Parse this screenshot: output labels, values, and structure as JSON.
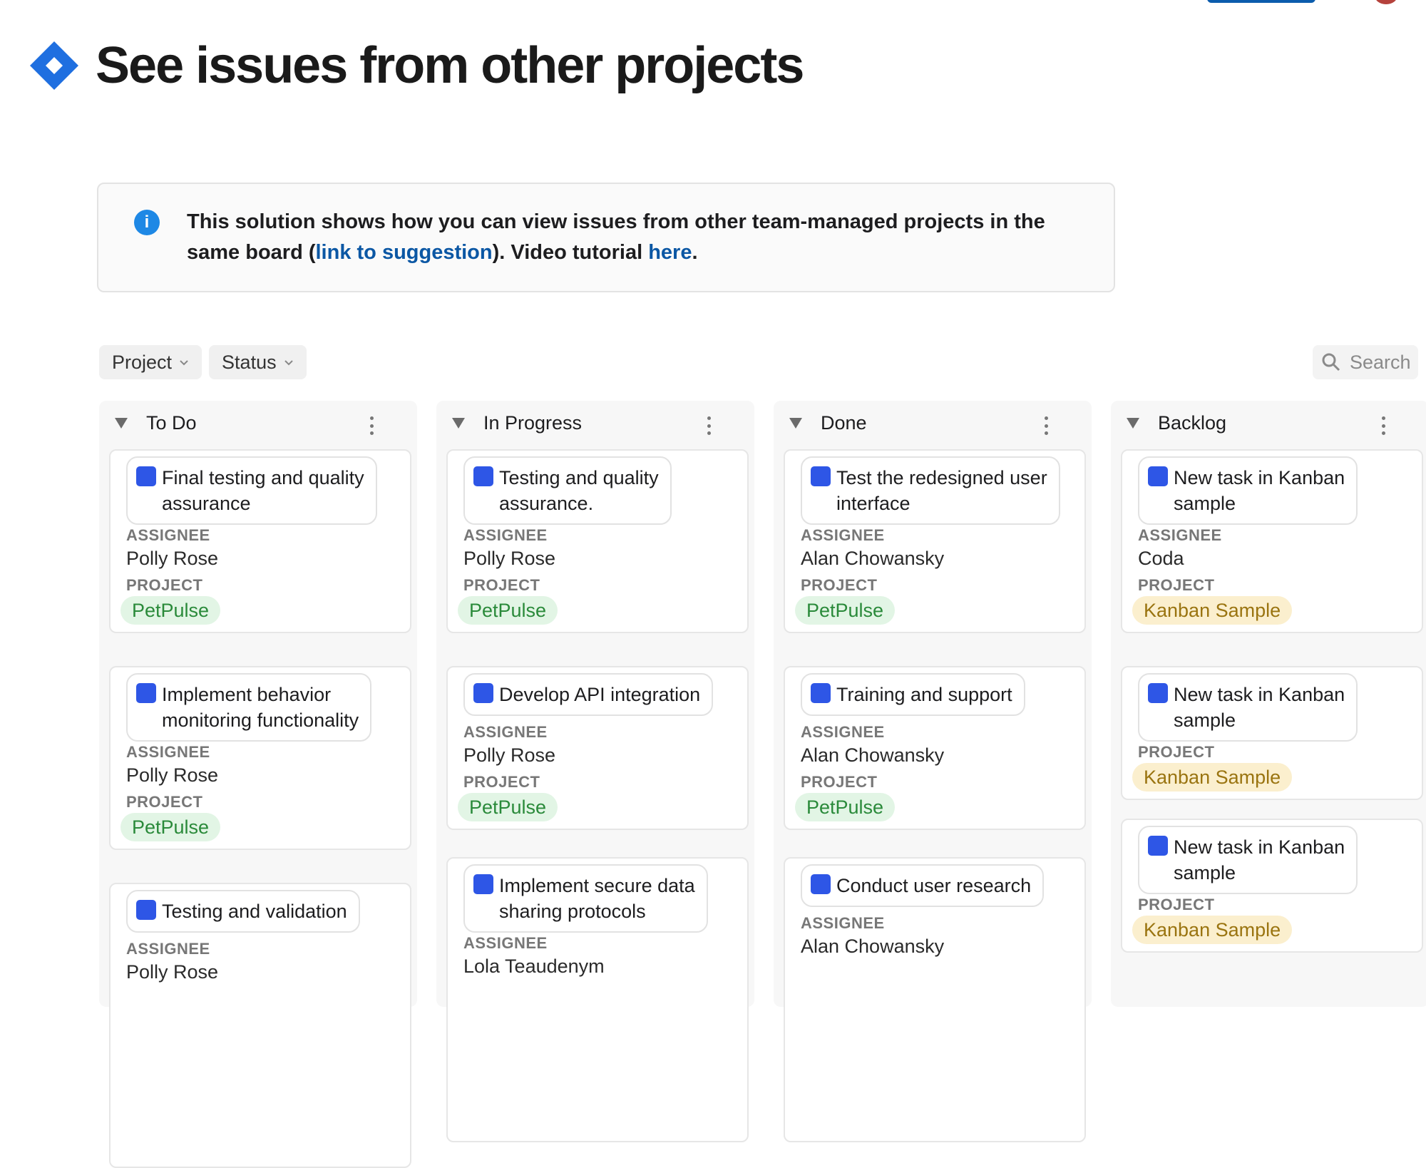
{
  "page": {
    "title": "See issues from other projects"
  },
  "callout": {
    "text_part1": "This solution shows how you can view issues from other team-managed projects in the same board (",
    "link1": "link to suggestion",
    "text_part2": "). Video tutorial ",
    "link2": "here",
    "text_part3": "."
  },
  "filters": {
    "project": "Project",
    "status": "Status",
    "search": "Search"
  },
  "labels": {
    "assignee": "ASSIGNEE",
    "project": "PROJECT"
  },
  "colors": {
    "accent": "#0b57a4",
    "info": "#1e88e5",
    "task_icon": "#2e56e6",
    "tag_green": "#2a8a3a",
    "tag_yellow": "#9a7410"
  },
  "columns": [
    {
      "title": "To Do",
      "cards": [
        {
          "title_lines": [
            "Final testing and quality",
            "assurance"
          ],
          "assignee": "Polly Rose",
          "project": "PetPulse"
        },
        {
          "title_lines": [
            "Implement behavior",
            "monitoring functionality"
          ],
          "assignee": "Polly Rose",
          "project": "PetPulse"
        },
        {
          "title_lines": [
            "Testing and validation"
          ],
          "assignee": "Polly Rose",
          "project": ""
        }
      ]
    },
    {
      "title": "In Progress",
      "cards": [
        {
          "title_lines": [
            "Testing and quality",
            "assurance."
          ],
          "assignee": "Polly Rose",
          "project": "PetPulse"
        },
        {
          "title_lines": [
            "Develop API integration"
          ],
          "assignee": "Polly Rose",
          "project": "PetPulse"
        },
        {
          "title_lines": [
            "Implement secure data",
            "sharing protocols"
          ],
          "assignee": "Lola Teaudenym",
          "project": ""
        }
      ]
    },
    {
      "title": "Done",
      "cards": [
        {
          "title_lines": [
            "Test the redesigned user",
            "interface"
          ],
          "assignee": "Alan Chowansky",
          "project": "PetPulse"
        },
        {
          "title_lines": [
            "Training and support"
          ],
          "assignee": "Alan Chowansky",
          "project": "PetPulse"
        },
        {
          "title_lines": [
            "Conduct user research"
          ],
          "assignee": "Alan Chowansky",
          "project": ""
        }
      ]
    },
    {
      "title": "Backlog",
      "cards": [
        {
          "title_lines": [
            "New task in Kanban",
            "sample"
          ],
          "assignee": "Coda",
          "project": "Kanban Sample"
        },
        {
          "title_lines": [
            "New task in Kanban",
            "sample"
          ],
          "assignee": "",
          "project": "Kanban Sample"
        },
        {
          "title_lines": [
            "New task in Kanban",
            "sample"
          ],
          "assignee": "",
          "project": "Kanban Sample"
        }
      ]
    }
  ]
}
